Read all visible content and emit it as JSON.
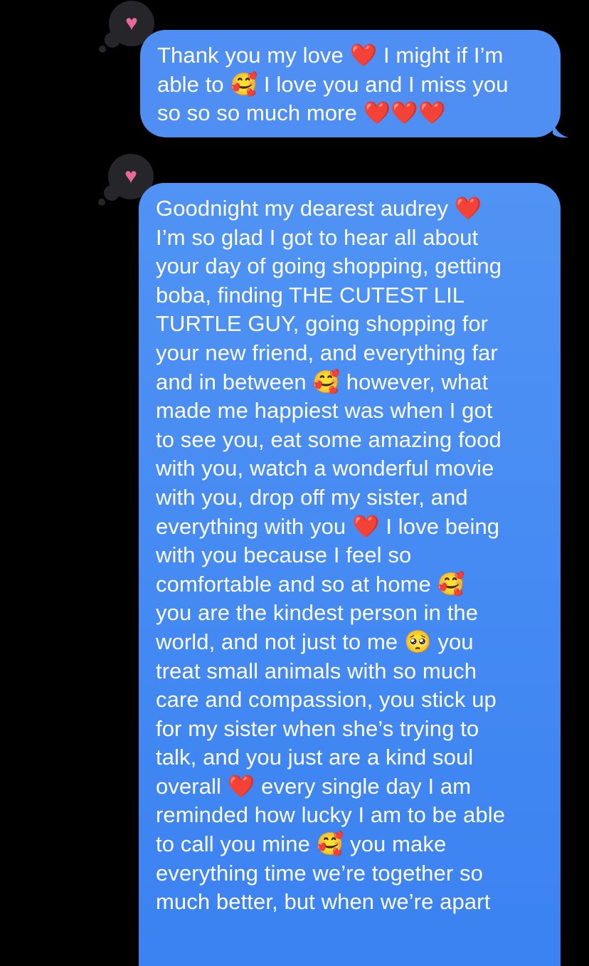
{
  "messages": [
    {
      "tapback": "heart-icon",
      "lines": [
        "Thank you my love ❤️ I might if I’m",
        "able to 🥰 I love you and I miss you",
        "so so so much more ❤️❤️❤️"
      ]
    },
    {
      "tapback": "heart-icon",
      "lines": [
        "Goodnight my dearest audrey ❤️",
        "I’m so glad I got to hear all about",
        "your day of going shopping, getting",
        "boba, finding THE CUTEST LIL",
        "TURTLE GUY, going shopping for",
        "your new friend, and everything far",
        "and in between 🥰 however, what",
        "made me happiest was when I got",
        "to see you, eat some amazing food",
        "with you, watch a wonderful movie",
        "with you, drop off my sister, and",
        "everything with you ❤️ I love being",
        "with you because I feel so",
        "comfortable and so at home 🥰",
        "you are the kindest person in the",
        "world, and not just to me 🥺 you",
        "treat small animals with so much",
        "care and compassion, you stick up",
        "for my sister when she’s trying to",
        "talk, and you just are a kind soul",
        "overall ❤️ every single day I am",
        "reminded how lucky I am to be able",
        "to call you mine 🥰 you make",
        "everything time we’re together so",
        "much better, but when we’re apart"
      ]
    }
  ],
  "colors": {
    "bubble": "#4f8ff4",
    "tapback_bg": "#26262a",
    "heart": "#e8689a"
  }
}
